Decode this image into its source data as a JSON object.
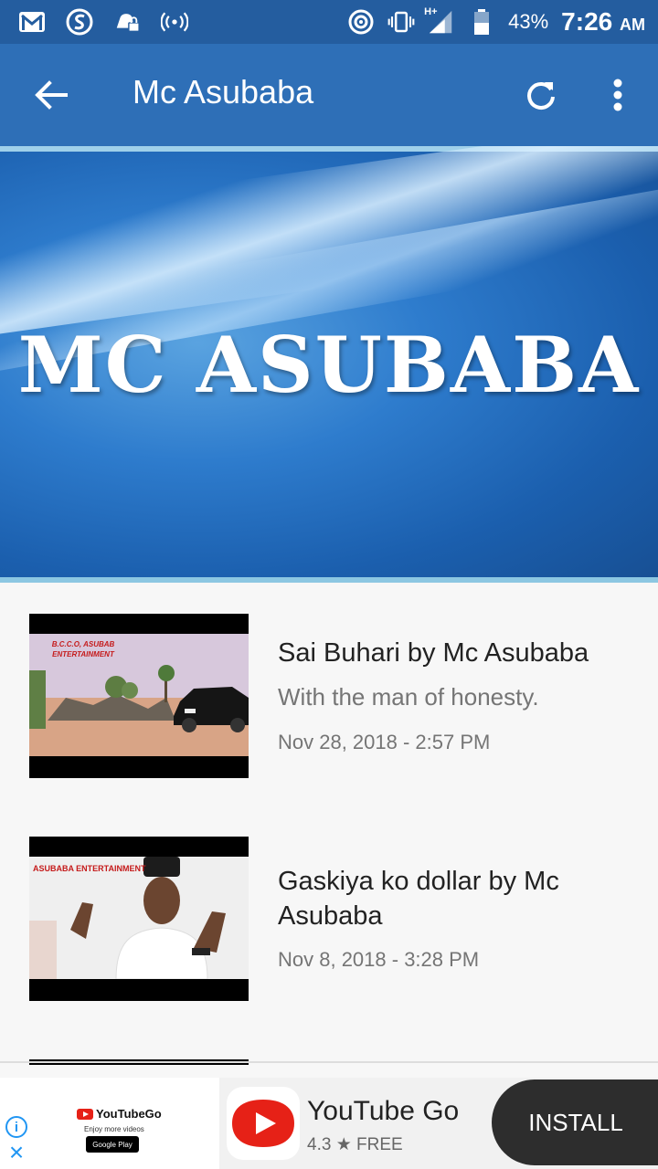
{
  "status_bar": {
    "battery": "43%",
    "time": "7:26",
    "ampm": "AM",
    "network": "H+"
  },
  "app_bar": {
    "title": "Mc Asubaba"
  },
  "banner": {
    "text": "MC ASUBABA"
  },
  "videos": [
    {
      "title": "Sai Buhari by Mc Asubaba",
      "description": "With the man of honesty.",
      "date": "Nov 28, 2018 - 2:57 PM",
      "thumb_caption": "B.C.C.O, ASUBAB ENTERTAINMENT"
    },
    {
      "title": "Gaskiya ko dollar by Mc Asubaba",
      "description": "",
      "date": "Nov 8, 2018 - 3:28 PM",
      "thumb_caption": "ASUBABA ENTERTAINMENT"
    }
  ],
  "ad": {
    "small_logo": "YouTubeGo",
    "tagline": "Enjoy more videos",
    "store_badge": "Google Play",
    "app_name": "YouTube Go",
    "rating": "4.3 ★ FREE",
    "install_label": "INSTALL"
  },
  "colors": {
    "status_bar": "#245d9f",
    "app_bar": "#2e6fb7",
    "accent_red": "#e62117"
  }
}
